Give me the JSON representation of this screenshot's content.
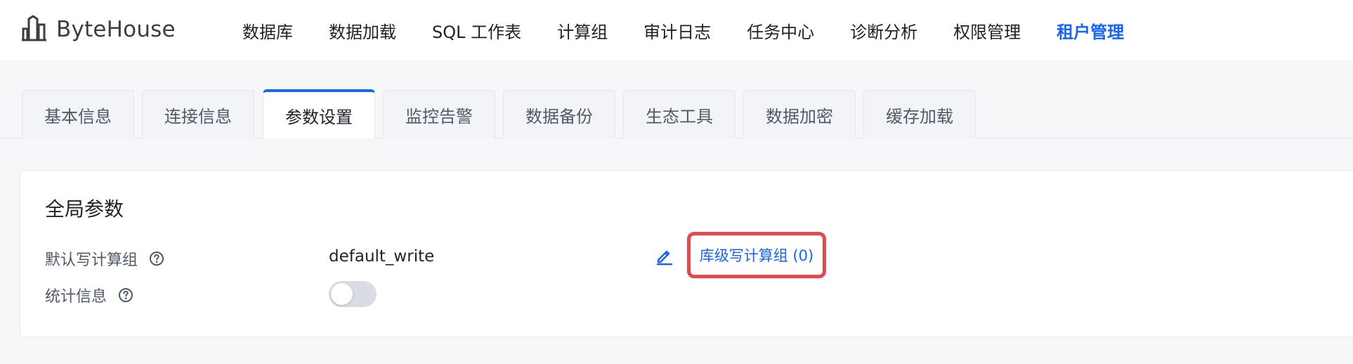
{
  "app": {
    "logo_text": "ByteHouse",
    "accent_color": "#1664ff",
    "highlight_color": "#e5484d"
  },
  "nav": {
    "items": [
      {
        "label": "数据库",
        "icon": ""
      },
      {
        "label": "数据加载",
        "icon": ""
      },
      {
        "label": "SQL 工作表",
        "icon": ""
      },
      {
        "label": "计算组",
        "icon": ""
      },
      {
        "label": "审计日志",
        "icon": ""
      },
      {
        "label": "任务中心",
        "icon": ""
      },
      {
        "label": "诊断分析",
        "icon": ""
      },
      {
        "label": "权限管理",
        "icon": ""
      },
      {
        "label": "租户管理",
        "icon": "",
        "active": true
      }
    ]
  },
  "tabs": {
    "items": [
      {
        "label": "基本信息"
      },
      {
        "label": "连接信息"
      },
      {
        "label": "参数设置",
        "active": true
      },
      {
        "label": "监控告警"
      },
      {
        "label": "数据备份"
      },
      {
        "label": "生态工具"
      },
      {
        "label": "数据加密"
      },
      {
        "label": "缓存加载"
      }
    ]
  },
  "global_params": {
    "title": "全局参数",
    "default_write_label": "默认写计算组",
    "default_write_value": "default_write",
    "db_write_link": "库级写计算组 (0)",
    "stats_label": "统计信息",
    "stats_enabled": false
  },
  "icons": {
    "help": "question-circle-icon",
    "edit": "pencil-icon",
    "logo": "bytehouse-logo-icon"
  }
}
